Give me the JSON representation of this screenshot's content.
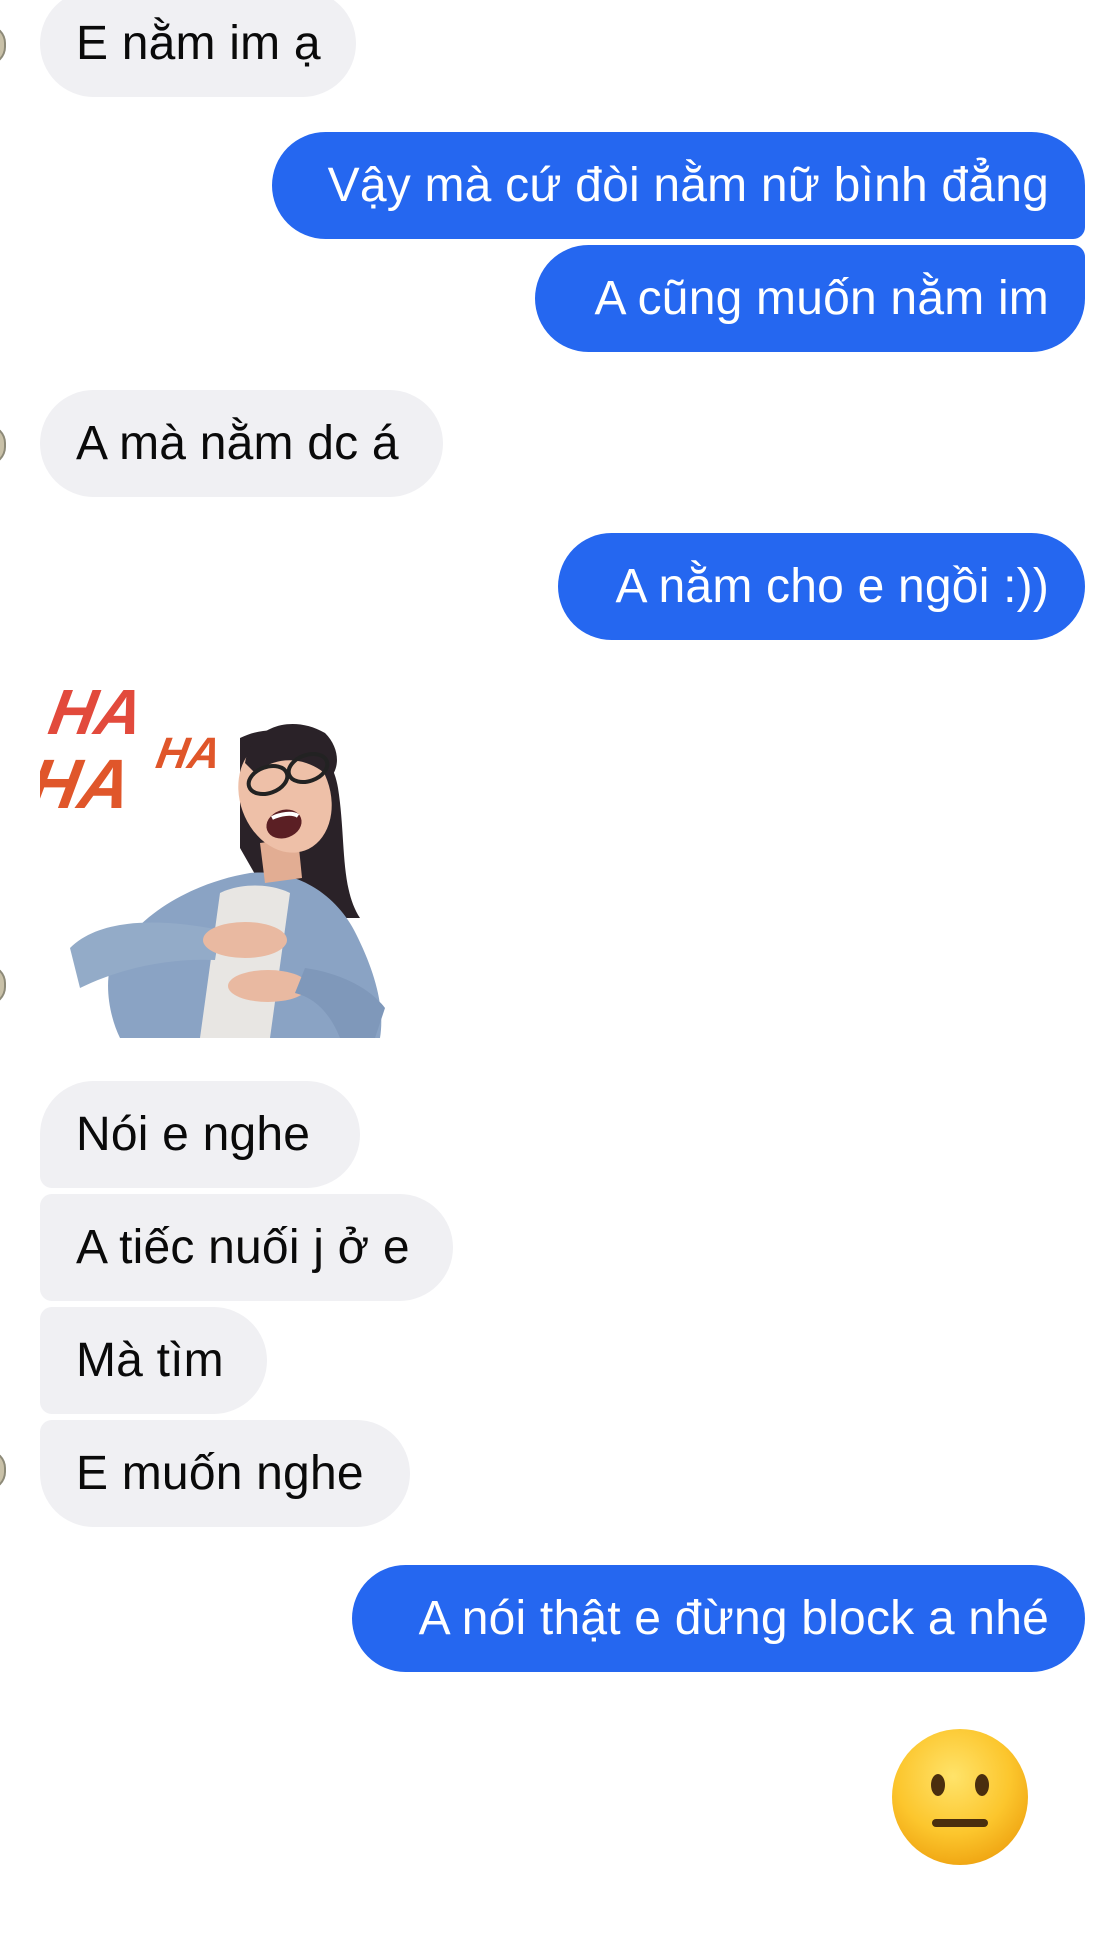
{
  "messages": [
    {
      "text": "E nằm im ạ",
      "sender": "them"
    },
    {
      "text": "Vậy mà cứ đòi nằm nữ bình đẳng",
      "sender": "me"
    },
    {
      "text": "A cũng muốn nằm im",
      "sender": "me"
    },
    {
      "text": "A mà nằm dc á",
      "sender": "them"
    },
    {
      "text": "A nằm cho e ngồi :))",
      "sender": "me"
    },
    {
      "text": "Nói e nghe",
      "sender": "them"
    },
    {
      "text": "A tiếc nuối j ở e",
      "sender": "them"
    },
    {
      "text": "Mà tìm",
      "sender": "them"
    },
    {
      "text": "E muốn nghe",
      "sender": "them"
    },
    {
      "text": "A nói thật e đừng block a nhé",
      "sender": "me"
    }
  ],
  "sticker": {
    "text_big": "HA",
    "text_small": "HA",
    "icon": "laughing-woman-sticker"
  },
  "reaction_emoji": {
    "icon": "neutral-face-emoji"
  },
  "colors": {
    "outgoing_bubble": "#2567f0",
    "incoming_bubble": "#f0f0f3",
    "outgoing_text": "#ffffff",
    "incoming_text": "#0a0a0a"
  }
}
